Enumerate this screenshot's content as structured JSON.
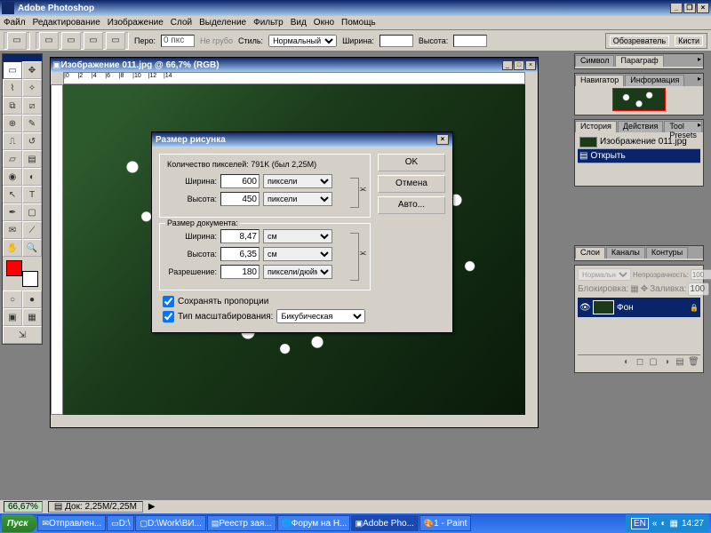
{
  "app": {
    "title": "Adobe Photoshop"
  },
  "menu": [
    "Файл",
    "Редактирование",
    "Изображение",
    "Слой",
    "Выделение",
    "Фильтр",
    "Вид",
    "Окно",
    "Помощь"
  ],
  "optionsbar": {
    "feather_label": "Перо:",
    "feather_value": "0 пкс",
    "antialias": "Не грубо",
    "style_label": "Стиль:",
    "style_value": "Нормальный",
    "width_label": "Ширина:",
    "height_label": "Высота:"
  },
  "palette_well": [
    "Обозреватель",
    "Кисти"
  ],
  "doc": {
    "title": "Изображение 011.jpg @ 66,7% (RGB)"
  },
  "dialog": {
    "title": "Размер рисунка",
    "pixel_count": "Количество пикселей: 791K (был 2,25M)",
    "width_label": "Ширина:",
    "height_label": "Высота:",
    "px_width": "600",
    "px_height": "450",
    "px_unit": "пиксели",
    "doc_size_label": "Размер документа:",
    "doc_width": "8,47",
    "doc_height": "6,35",
    "doc_unit": "см",
    "res_label": "Разрешение:",
    "res_value": "180",
    "res_unit": "пиксели/дюйм",
    "constrain": "Сохранять пропорции",
    "resample": "Тип масштабирования:",
    "resample_method": "Бикубическая",
    "ok": "OK",
    "cancel": "Отмена",
    "auto": "Авто..."
  },
  "panels": {
    "char_tabs": [
      "Символ",
      "Параграф"
    ],
    "nav_tabs": [
      "Навигатор",
      "Информация"
    ],
    "hist_tabs": [
      "История",
      "Действия",
      "Tool Presets"
    ],
    "hist_items": [
      "Изображение 011.jpg",
      "Открыть"
    ],
    "color_tabs": [
      "Слои",
      "Каналы",
      "Контуры"
    ],
    "layers": {
      "mode": "Нормальный",
      "opacity_label": "Непрозрачность:",
      "opacity": "100",
      "lock_label": "Блокировка:",
      "fill_label": "Заливка:",
      "fill": "100",
      "layer_name": "Фон"
    }
  },
  "status": {
    "zoom": "66,67%",
    "doc": "Док: 2,25M/2,25M"
  },
  "taskbar": {
    "start": "Пуск",
    "items": [
      "Отправлен...",
      "D:\\",
      "D:\\Work\\ВИ...",
      "Реестр зая...",
      "Форум на Н...",
      "Adobe Pho...",
      "1 - Paint"
    ],
    "lang": "EN",
    "time": "14:27"
  }
}
